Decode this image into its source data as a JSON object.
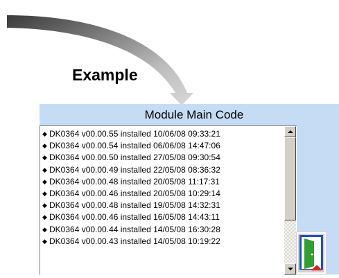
{
  "caption": "Example",
  "panel": {
    "title": "Module Main Code",
    "background": "#c6dcf5"
  },
  "module_list": [
    {
      "code": "DK0364",
      "version": "v00.00.55",
      "status": "installed",
      "date": "10/06/08",
      "time": "09:33:21",
      "text": "DK0364  v00.00.55 installed 10/06/08 09:33:21"
    },
    {
      "code": "DK0364",
      "version": "v00.00.54",
      "status": "installed",
      "date": "06/06/08",
      "time": "14:47:06",
      "text": "DK0364  v00.00.54 installed 06/06/08 14:47:06"
    },
    {
      "code": "DK0364",
      "version": "v00.00.50",
      "status": "installed",
      "date": "27/05/08",
      "time": "09:30:54",
      "text": "DK0364  v00.00.50 installed 27/05/08 09:30:54"
    },
    {
      "code": "DK0364",
      "version": "v00.00.49",
      "status": "installed",
      "date": "22/05/08",
      "time": "08:36:32",
      "text": "DK0364  v00.00.49 installed 22/05/08 08:36:32"
    },
    {
      "code": "DK0364",
      "version": "v00.00.48",
      "status": "installed",
      "date": "20/05/08",
      "time": "11:17:31",
      "text": "DK0364  v00.00.48 installed 20/05/08 11:17:31"
    },
    {
      "code": "DK0364",
      "version": "v00.00.46",
      "status": "installed",
      "date": "20/05/08",
      "time": "10:29:14",
      "text": "DK0364  v00.00.46 installed 20/05/08 10:29:14"
    },
    {
      "code": "DK0364",
      "version": "v00.00.48",
      "status": "installed",
      "date": "19/05/08",
      "time": "14:32:31",
      "text": "DK0364  v00.00.48 installed 19/05/08 14:32:31"
    },
    {
      "code": "DK0364",
      "version": "v00.00.46",
      "status": "installed",
      "date": "16/05/08",
      "time": "14:43:11",
      "text": "DK0364  v00.00.46 installed 16/05/08 14:43:11"
    },
    {
      "code": "DK0364",
      "version": "v00.00.44",
      "status": "installed",
      "date": "14/05/08",
      "time": "16:30:28",
      "text": "DK0364  v00.00.44 installed 14/05/08 16:30:28"
    },
    {
      "code": "DK0364",
      "version": "v00.00.43",
      "status": "installed",
      "date": "14/05/08",
      "time": "10:19:22",
      "text": "DK0364  v00.00.43 installed 14/05/08 10:19:22"
    }
  ],
  "icons": {
    "bullet": "diamond-bullet-icon",
    "scroll_up": "arrow-up-icon",
    "scroll_down": "arrow-down-icon",
    "exit": "exit-door-icon",
    "callout": "curved-arrow-icon"
  },
  "colors": {
    "exit_door": "#30a030",
    "exit_frame": "#2050c0",
    "exit_arrow": "#e02020"
  }
}
